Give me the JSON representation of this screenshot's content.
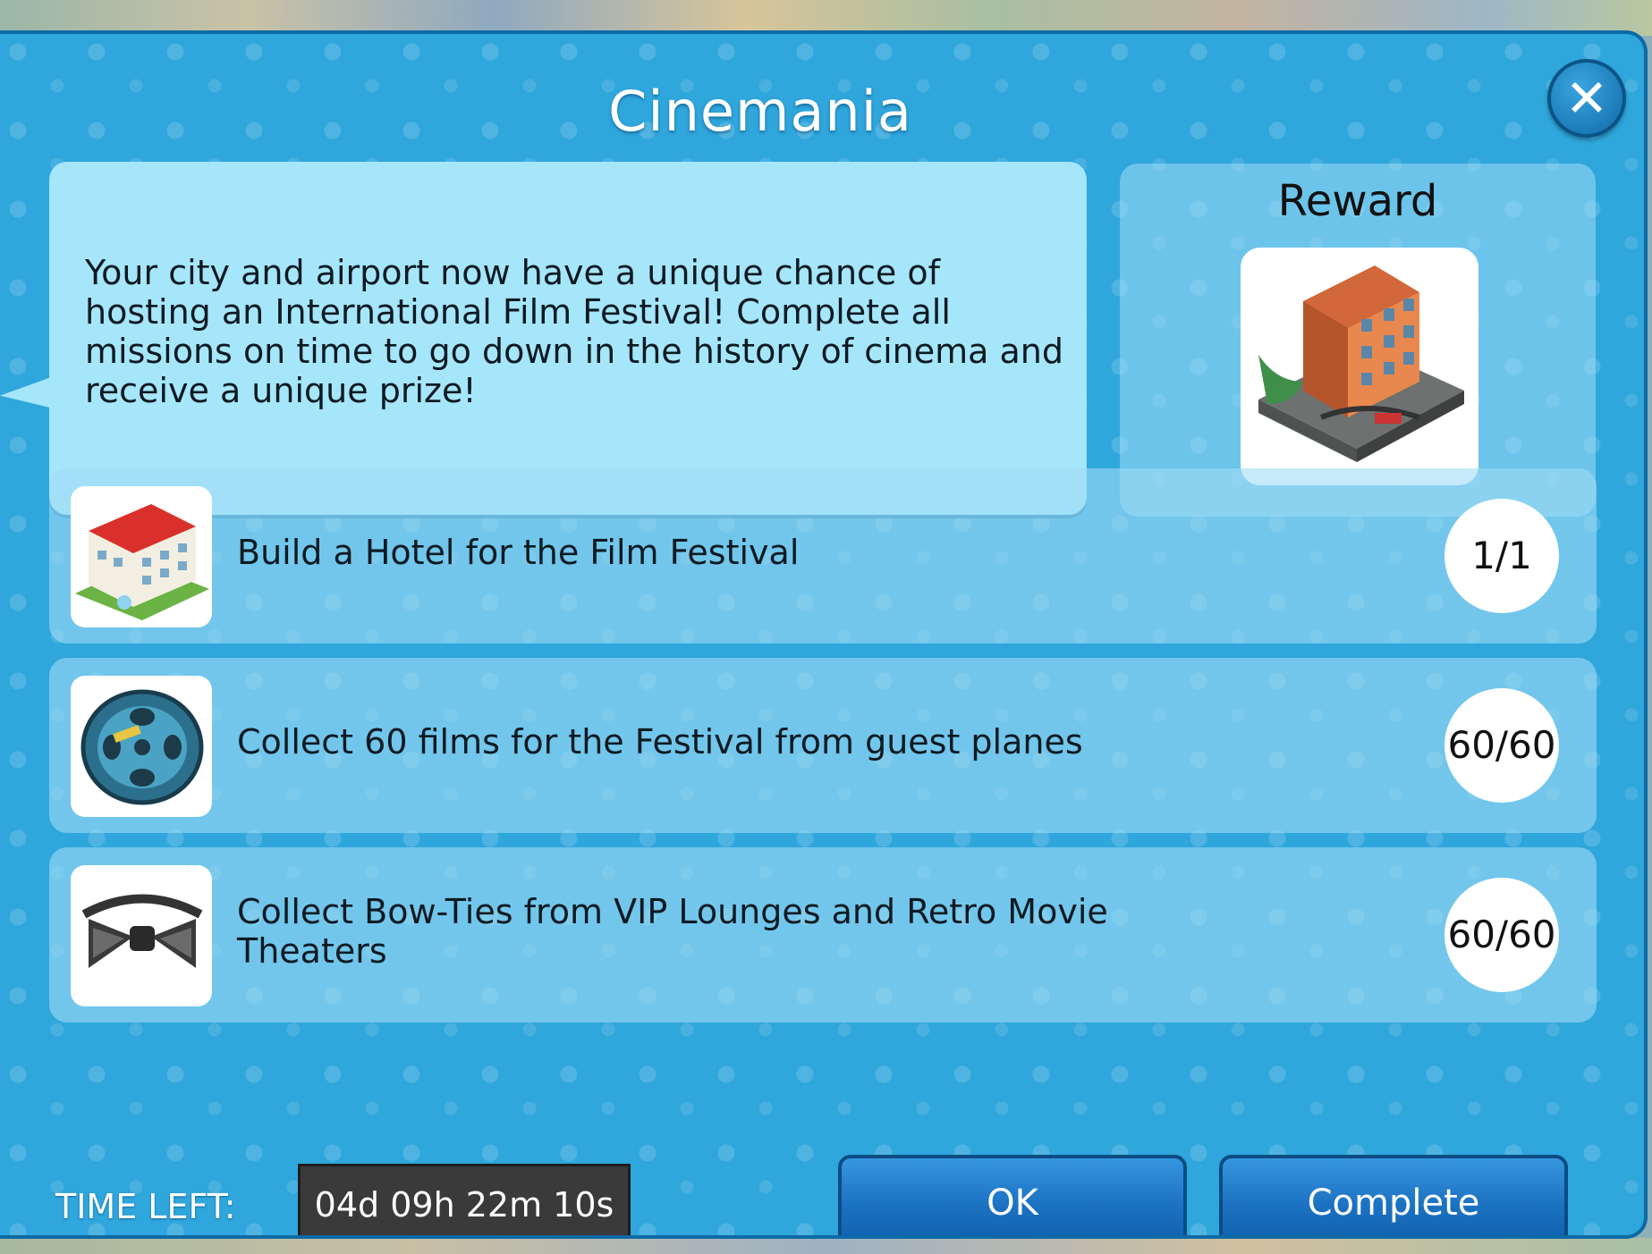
{
  "dialog": {
    "title": "Cinemania",
    "close_icon": "close-icon"
  },
  "description": {
    "text": "Your city and airport now have a unique chance of hosting an International Film Festival! Complete all missions on time to go down in the history of cinema and receive a unique prize!"
  },
  "reward": {
    "label": "Reward",
    "image": "film-studio-building-image"
  },
  "missions": [
    {
      "icon": "hotel-icon",
      "text": "Build a Hotel for the Film Festival",
      "count": "1/1"
    },
    {
      "icon": "film-reel-icon",
      "text": "Collect 60 films for the Festival from guest planes",
      "count": "60/60"
    },
    {
      "icon": "bow-tie-icon",
      "text": "Collect Bow-Ties from VIP Lounges and Retro Movie Theaters",
      "count": "60/60"
    }
  ],
  "footer": {
    "time_label": "TIME LEFT:",
    "time_value": "04d 09h 22m 10s",
    "ok_label": "OK",
    "complete_label": "Complete"
  },
  "colors": {
    "dialog_bg": "#2fa6dc",
    "desc_bg": "#a6e6fb",
    "button_blue": "#1c72c2"
  }
}
